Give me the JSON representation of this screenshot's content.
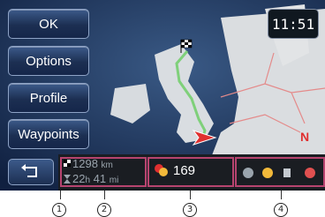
{
  "menu": {
    "ok_label": "OK",
    "options_label": "Options",
    "profile_label": "Profile",
    "waypoints_label": "Waypoints"
  },
  "clock": {
    "time": "11:51"
  },
  "info_bar": {
    "distance": "1298",
    "distance_unit": "km",
    "time_hours": "22",
    "time_h": "h",
    "time_minutes": "41",
    "time_min_unit": "mi",
    "poi_count": "169"
  },
  "callouts": [
    "1",
    "2",
    "3",
    "4"
  ],
  "map": {
    "compass_label": "N"
  },
  "colors": {
    "route": "#7fd07a",
    "menu_bg": "#1c2f52",
    "highlight_box": "#b7446f"
  },
  "icons": [
    "finish-flag-icon",
    "vehicle-arrow-icon",
    "back-icon",
    "poi-icon",
    "traffic-icons"
  ]
}
